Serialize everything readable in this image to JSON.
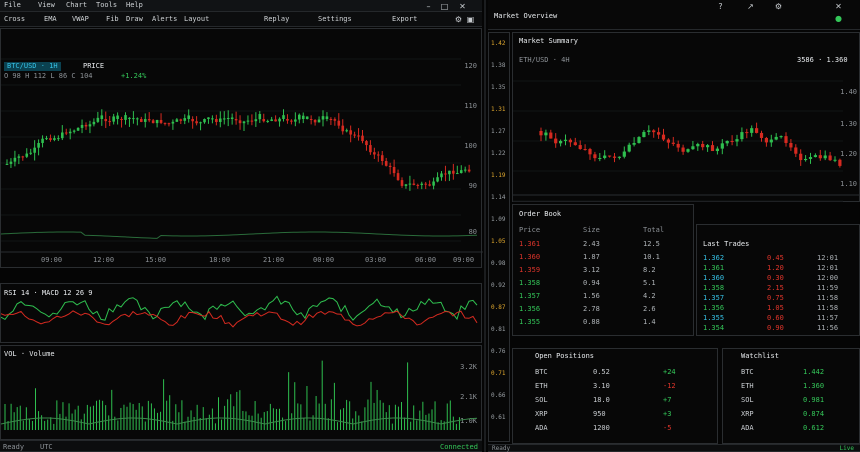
{
  "left": {
    "menu": [
      "File",
      "View",
      "Chart",
      "Tools",
      "Help"
    ],
    "toolbar": [
      "Cross",
      "EMA",
      "VWAP",
      "Fib",
      "Draw",
      "Alerts",
      "Layout",
      "Replay",
      "Settings",
      "Export"
    ],
    "chart_header": {
      "symbol": "BTC/USD · 1H",
      "label": "PRICE",
      "ohlc": "O 98 H 112 L 86 C 104",
      "change": "+1.24%"
    },
    "price_axis": [
      "120",
      "110",
      "100",
      "90",
      "80"
    ],
    "time_axis": [
      "09:00",
      "12:00",
      "15:00",
      "18:00",
      "21:00",
      "00:00",
      "03:00",
      "06:00",
      "09:00"
    ],
    "indicator_header": "RSI 14 · MACD 12 26 9",
    "volume_header": "VOL · Volume",
    "volume_axis": [
      "3.2K",
      "2.1K",
      "1.0K"
    ],
    "status": [
      "Ready",
      "UTC",
      "Connected"
    ]
  },
  "right": {
    "top_title": "Market Overview",
    "top_actions": [
      "?",
      "↗",
      "⚙",
      "✕"
    ],
    "side_values": [
      "1.42",
      "1.38",
      "1.35",
      "1.31",
      "1.27",
      "1.22",
      "1.19",
      "1.14",
      "1.09",
      "1.05",
      "0.98",
      "0.92",
      "0.87",
      "0.81",
      "0.76",
      "0.71",
      "0.66",
      "0.61"
    ],
    "chart2_title": "Market Summary",
    "chart2_sub": "ETH/USD · 4H",
    "chart2_stats": "3586 · 1.360",
    "chart2_axis": [
      "1.40",
      "1.30",
      "1.20",
      "1.10"
    ],
    "order_book_title": "Order Book",
    "order_book_header": [
      "Price",
      "Size",
      "Total"
    ],
    "order_book_rows": [
      [
        "1.361",
        "2.43",
        "12.5"
      ],
      [
        "1.360",
        "1.87",
        "10.1"
      ],
      [
        "1.359",
        "3.12",
        "8.2"
      ],
      [
        "1.358",
        "0.94",
        "5.1"
      ],
      [
        "1.357",
        "1.56",
        "4.2"
      ],
      [
        "1.356",
        "2.78",
        "2.6"
      ],
      [
        "1.355",
        "0.88",
        "1.4"
      ]
    ],
    "trades_title": "Last Trades",
    "trades_rows": [
      [
        "1.362",
        "0.45",
        "12:01"
      ],
      [
        "1.361",
        "1.20",
        "12:01"
      ],
      [
        "1.360",
        "0.30",
        "12:00"
      ],
      [
        "1.358",
        "2.15",
        "11:59"
      ],
      [
        "1.357",
        "0.75",
        "11:58"
      ],
      [
        "1.356",
        "1.05",
        "11:58"
      ],
      [
        "1.355",
        "0.60",
        "11:57"
      ],
      [
        "1.354",
        "0.90",
        "11:56"
      ]
    ],
    "positions_title": "Open Positions",
    "positions_rows": [
      [
        "BTC",
        "0.52",
        "+24"
      ],
      [
        "ETH",
        "3.10",
        "-12"
      ],
      [
        "SOL",
        "18.0",
        "+7"
      ],
      [
        "XRP",
        "950",
        "+3"
      ],
      [
        "ADA",
        "1200",
        "-5"
      ]
    ],
    "watchlist_title": "Watchlist",
    "watchlist_rows": [
      [
        "BTC",
        "1.442"
      ],
      [
        "ETH",
        "1.360"
      ],
      [
        "SOL",
        "0.981"
      ],
      [
        "XRP",
        "0.874"
      ],
      [
        "ADA",
        "0.612"
      ]
    ],
    "footer": [
      "Ready",
      "Live"
    ]
  }
}
